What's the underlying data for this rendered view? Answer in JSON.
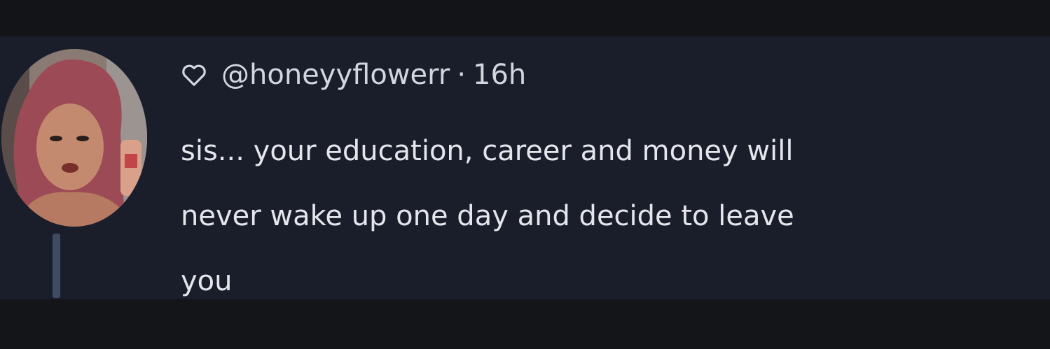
{
  "post": {
    "handle": "@honeyyflowerr",
    "separator": "·",
    "time": "16h",
    "text_lines": [
      "sis... your education, career and money will",
      "never wake up one day and decide to leave",
      "you"
    ]
  },
  "icons": {
    "heart": "heart-outline-icon",
    "avatar": "profile-avatar"
  },
  "colors": {
    "background": "#121318",
    "post_background": "#1a1e2b",
    "text": "#e4e6eb",
    "meta_text": "#d2d6de",
    "thread_line": "#3f4b60"
  }
}
